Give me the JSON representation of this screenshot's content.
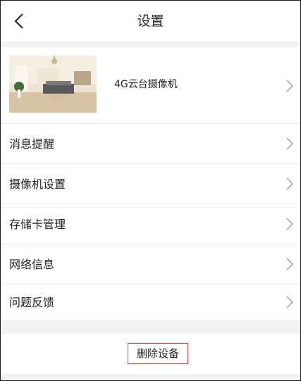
{
  "header": {
    "title": "设置"
  },
  "device": {
    "name": "4G云台摄像机"
  },
  "menu": [
    {
      "label": "消息提醒"
    },
    {
      "label": "摄像机设置"
    },
    {
      "label": "存储卡管理"
    },
    {
      "label": "网络信息"
    },
    {
      "label": "问题反馈"
    }
  ],
  "actions": {
    "delete_label": "删除设备"
  },
  "icons": {
    "back": "chevron-left-icon",
    "item_arrow": "chevron-right-icon"
  },
  "colors": {
    "delete_outline": "#e53935",
    "section_gap": "#f2f2f2"
  }
}
